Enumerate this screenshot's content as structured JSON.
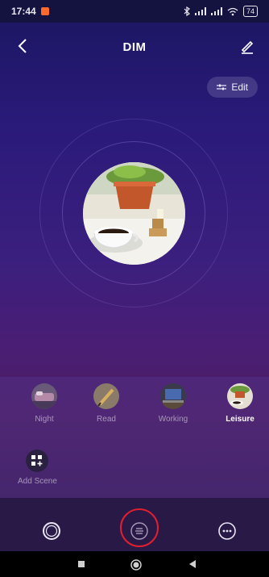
{
  "status": {
    "time": "17:44",
    "battery": "74"
  },
  "header": {
    "title": "DIM"
  },
  "edit": {
    "label": "Edit"
  },
  "scenes": [
    {
      "label": "Night",
      "active": false
    },
    {
      "label": "Read",
      "active": false
    },
    {
      "label": "Working",
      "active": false
    },
    {
      "label": "Leisure",
      "active": true
    }
  ],
  "add_scene": {
    "label": "Add Scene"
  },
  "colors": {
    "accent_highlight": "#e02030",
    "active_label": "#ffffff"
  },
  "nav": {
    "items": [
      "power-icon",
      "scenes-icon",
      "more-icon"
    ]
  }
}
